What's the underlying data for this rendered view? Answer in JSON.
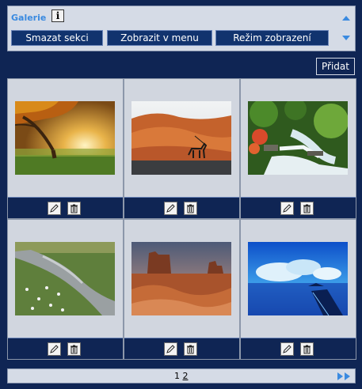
{
  "section": {
    "title": "Galerie",
    "info_glyph": "i",
    "buttons": [
      {
        "label": "Smazat sekci"
      },
      {
        "label": "Zobrazit v menu"
      },
      {
        "label": "Režim zobrazení"
      }
    ]
  },
  "add_label": "Přidat",
  "gallery": {
    "photos": [
      {
        "alt": "autumn-tree-sunset",
        "icon": "photo"
      },
      {
        "alt": "desert-oryx",
        "icon": "photo"
      },
      {
        "alt": "jungle-waterfall",
        "icon": "photo"
      },
      {
        "alt": "flower-meadow-stream",
        "icon": "photo"
      },
      {
        "alt": "monument-valley",
        "icon": "photo"
      },
      {
        "alt": "tropical-pier-sea",
        "icon": "photo"
      }
    ]
  },
  "pager": {
    "page_1": "1",
    "page_2": "2"
  },
  "colors": {
    "background": "#0f2554",
    "panel": "#d5dbe6",
    "accent": "#3a8ae0",
    "button": "#11336e"
  }
}
